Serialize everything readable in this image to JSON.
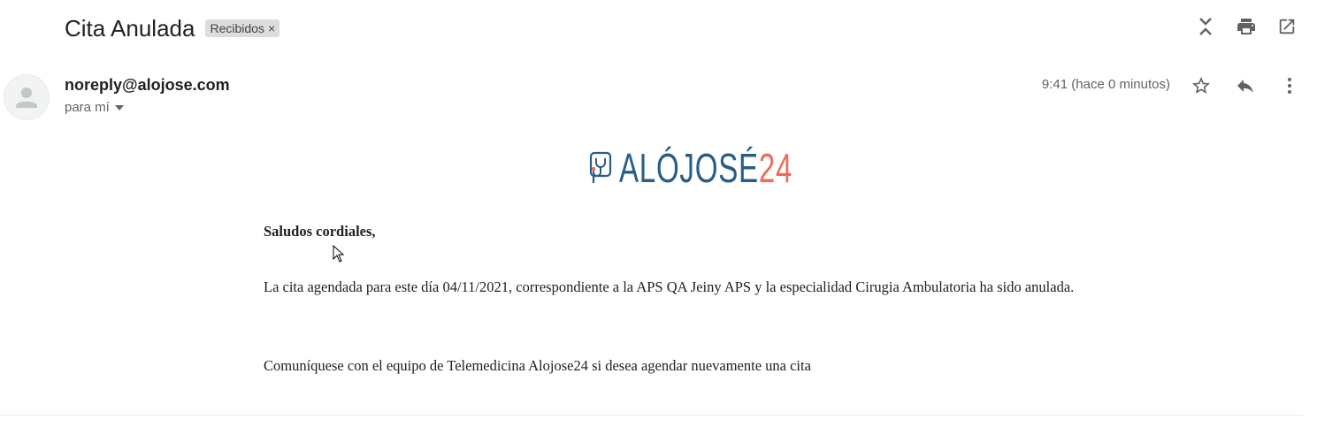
{
  "email": {
    "subject": "Cita Anulada",
    "label": "Recibidos",
    "label_remove": "×",
    "sender": "noreply@alojose.com",
    "recipient": "para mí",
    "time": "9:41 (hace 0 minutos)"
  },
  "toolbar": {
    "icons": [
      "collapse-all-icon",
      "print-icon",
      "open-new-window-icon"
    ]
  },
  "message_actions": {
    "icons": [
      "star-icon",
      "reply-icon",
      "more-vert-icon"
    ]
  },
  "logo": {
    "brand_text": "ALÓJOSÉ",
    "brand_number": "24",
    "colors": {
      "main": "#2a5d86",
      "accent": "#ef6c58"
    }
  },
  "body": {
    "greeting": "Saludos cordiales,",
    "paragraph1": "La cita agendada para este día 04/11/2021, correspondiente a la APS QA Jeiny APS y la especialidad Cirugia Ambulatoria ha sido anulada.",
    "paragraph2": "Comuníquese con el equipo de Telemedicina Alojose24 si desea agendar nuevamente una cita"
  }
}
